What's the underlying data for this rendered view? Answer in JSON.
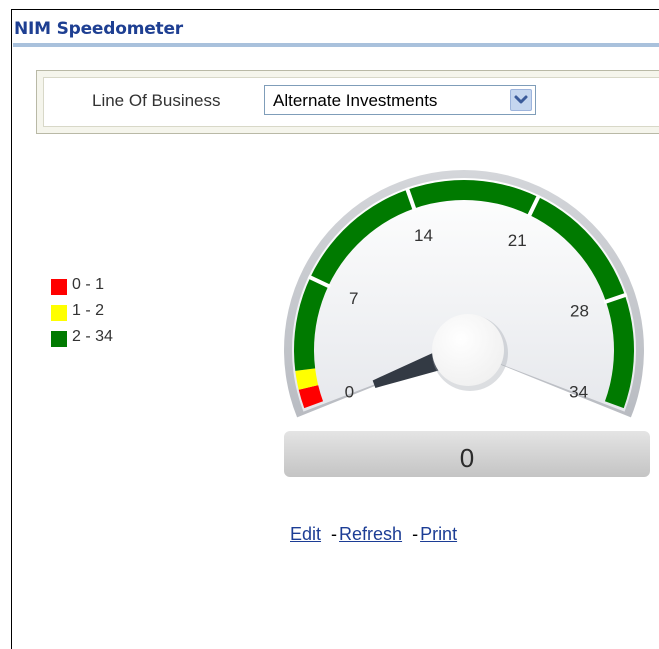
{
  "panel": {
    "title": "NIM Speedometer"
  },
  "prompt": {
    "label": "Line Of Business",
    "selected": "Alternate Investments"
  },
  "legend": [
    {
      "label": "0 - 1",
      "color": "#ff0000"
    },
    {
      "label": "1 - 2",
      "color": "#ffff00"
    },
    {
      "label": "2 - 34",
      "color": "#007a00"
    }
  ],
  "gauge": {
    "ticks": [
      "0",
      "7",
      "14",
      "21",
      "28",
      "34"
    ],
    "value": 0,
    "readout": "0",
    "needle_color": "#333a44"
  },
  "links": {
    "edit": "Edit",
    "sep1": "-",
    "refresh": "Refresh",
    "sep2": "-",
    "print": "Print"
  }
}
